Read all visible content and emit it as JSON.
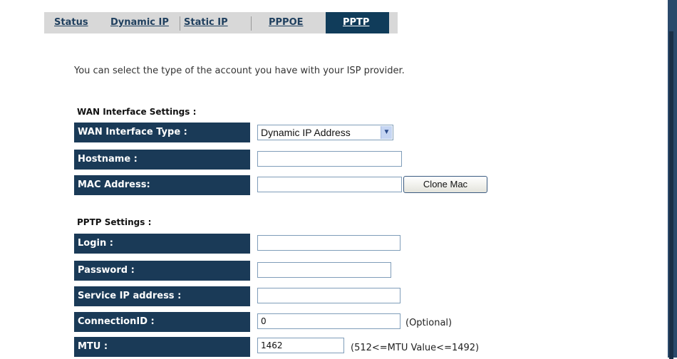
{
  "tabs": [
    {
      "label": "Status"
    },
    {
      "label": "Dynamic IP"
    },
    {
      "label": "Static IP"
    },
    {
      "label": "PPPOE"
    },
    {
      "label": "PPTP"
    }
  ],
  "intro": "You can select the type of the account you have with your ISP provider.",
  "wan": {
    "title": "WAN Interface Settings :",
    "type_label": "WAN Interface Type :",
    "type_value": "Dynamic IP Address",
    "hostname_label": "Hostname :",
    "hostname_value": "",
    "mac_label": "MAC Address:",
    "mac_value": "",
    "clone_button": "Clone Mac"
  },
  "pptp": {
    "title": "PPTP Settings :",
    "login_label": "Login :",
    "login_value": "",
    "password_label": "Password :",
    "password_value": "",
    "service_ip_label": "Service IP address :",
    "service_ip_value": "",
    "connection_id_label": "ConnectionID :",
    "connection_id_value": "0",
    "connection_id_hint": "(Optional)",
    "mtu_label": "MTU :",
    "mtu_value": "1462",
    "mtu_hint": "(512<=MTU Value<=1492)"
  }
}
